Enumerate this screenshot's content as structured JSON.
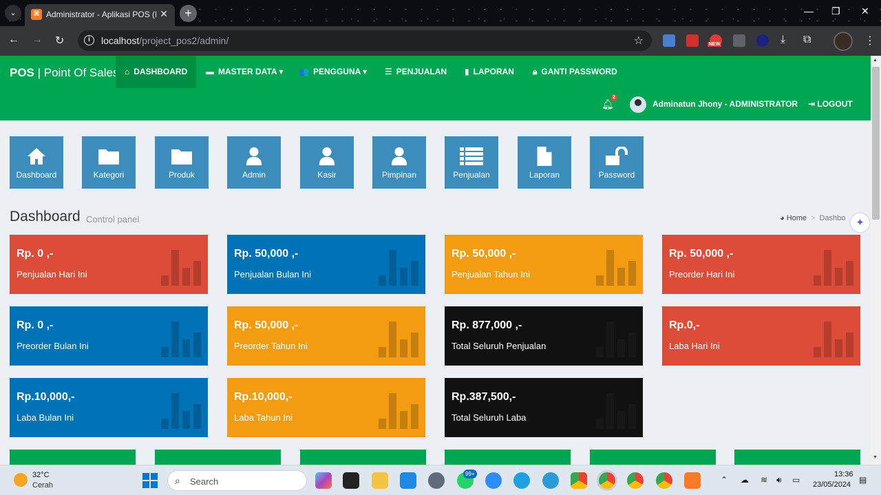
{
  "browser": {
    "tab_title": "Administrator - Aplikasi POS (P",
    "url_host": "localhost",
    "url_path": "/project_pos2/admin/",
    "ext_badge": "NEW"
  },
  "navbar": {
    "brand_bold": "POS",
    "brand_rest": " | Point Of Sales",
    "menu": [
      {
        "label": "DASHBOARD",
        "icon": "home-icon"
      },
      {
        "label": "MASTER DATA ▾",
        "icon": "folder-icon"
      },
      {
        "label": "PENGGUNA ▾",
        "icon": "users-icon"
      },
      {
        "label": "PENJUALAN",
        "icon": "list-icon"
      },
      {
        "label": "LAPORAN",
        "icon": "file-icon"
      },
      {
        "label": "GANTI PASSWORD",
        "icon": "lock-icon"
      }
    ],
    "notif_count": "2",
    "user": "Adminatun Jhony - ADMINISTRATOR",
    "logout": "LOGOUT"
  },
  "shortcuts": [
    {
      "label": "Dashboard",
      "icon": "home-icon"
    },
    {
      "label": "Kategori",
      "icon": "folder-icon"
    },
    {
      "label": "Produk",
      "icon": "folder-icon"
    },
    {
      "label": "Admin",
      "icon": "user-icon"
    },
    {
      "label": "Kasir",
      "icon": "user-icon"
    },
    {
      "label": "Pimpinan",
      "icon": "user-icon"
    },
    {
      "label": "Penjualan",
      "icon": "list-icon"
    },
    {
      "label": "Laporan",
      "icon": "file-icon"
    },
    {
      "label": "Password",
      "icon": "unlock-icon"
    }
  ],
  "header": {
    "title": "Dashboard",
    "subtitle": "Control panel",
    "crumb_home": "Home",
    "crumb_current": "Dashbo"
  },
  "stats": [
    {
      "amount": "Rp. 0 ,-",
      "label": "Penjualan Hari Ini",
      "color": "#dd4b39"
    },
    {
      "amount": "Rp. 50,000 ,-",
      "label": "Penjualan Bulan Ini",
      "color": "#0073b7"
    },
    {
      "amount": "Rp. 50,000 ,-",
      "label": "Penjualan Tahun Ini",
      "color": "#f39c12"
    },
    {
      "amount": "Rp. 50,000 ,-",
      "label": "Preorder Hari Ini",
      "color": "#dd4b39"
    },
    {
      "amount": "Rp. 0 ,-",
      "label": "Preorder Bulan Ini",
      "color": "#0073b7"
    },
    {
      "amount": "Rp. 50,000 ,-",
      "label": "Preorder Tahun Ini",
      "color": "#f39c12"
    },
    {
      "amount": "Rp. 877,000 ,-",
      "label": "Total Seluruh Penjualan",
      "color": "#111111"
    },
    {
      "amount": "Rp.0,-",
      "label": "Laba Hari Ini",
      "color": "#dd4b39"
    },
    {
      "amount": "Rp.10,000,-",
      "label": "Laba Bulan Ini",
      "color": "#0073b7"
    },
    {
      "amount": "Rp.10,000,-",
      "label": "Laba Tahun Ini",
      "color": "#f39c12"
    },
    {
      "amount": "Rp.387,500,-",
      "label": "Total Seluruh Laba",
      "color": "#111111"
    }
  ],
  "taskbar": {
    "temp": "32°C",
    "condition": "Cerah",
    "search": "Search",
    "badge": "99+",
    "time": "13:36",
    "date": "23/05/2024"
  }
}
